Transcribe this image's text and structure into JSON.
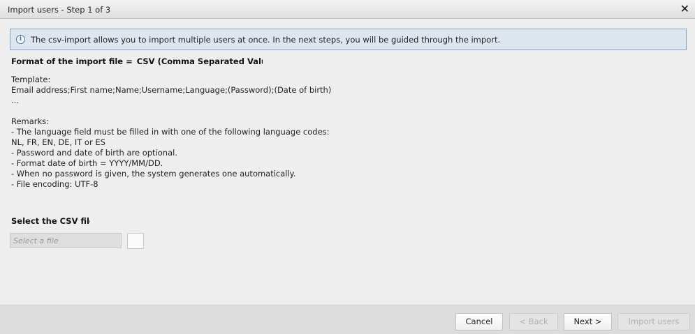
{
  "window": {
    "title": "Import users - Step 1 of 3",
    "close_glyph": "✕"
  },
  "info": {
    "icon": "info-icon",
    "glyph": "i",
    "text": "The csv-import allows you to import multiple users at once. In the next steps, you will be guided through the import."
  },
  "format": {
    "label": "Format of the import file =",
    "value": "CSV (Comma Separated Values)"
  },
  "template": {
    "lines": [
      "Template:",
      "Email address;First name;Name;Username;Language;(Password);(Date of birth)",
      "..."
    ]
  },
  "remarks": {
    "lines": [
      "Remarks:",
      "- The language field must be filled in with one of the following language codes:",
      "NL, FR, EN, DE, IT or ES",
      "- Password and date of birth are optional.",
      "- Format date of birth = YYYY/MM/DD.",
      "- When no password is given, the system generates one automatically.",
      "- File encoding: UTF-8"
    ]
  },
  "file": {
    "label": "Select the CSV file",
    "placeholder": "Select a file"
  },
  "footer": {
    "cancel": "Cancel",
    "back": "< Back",
    "next": "Next >",
    "import": "Import users"
  }
}
